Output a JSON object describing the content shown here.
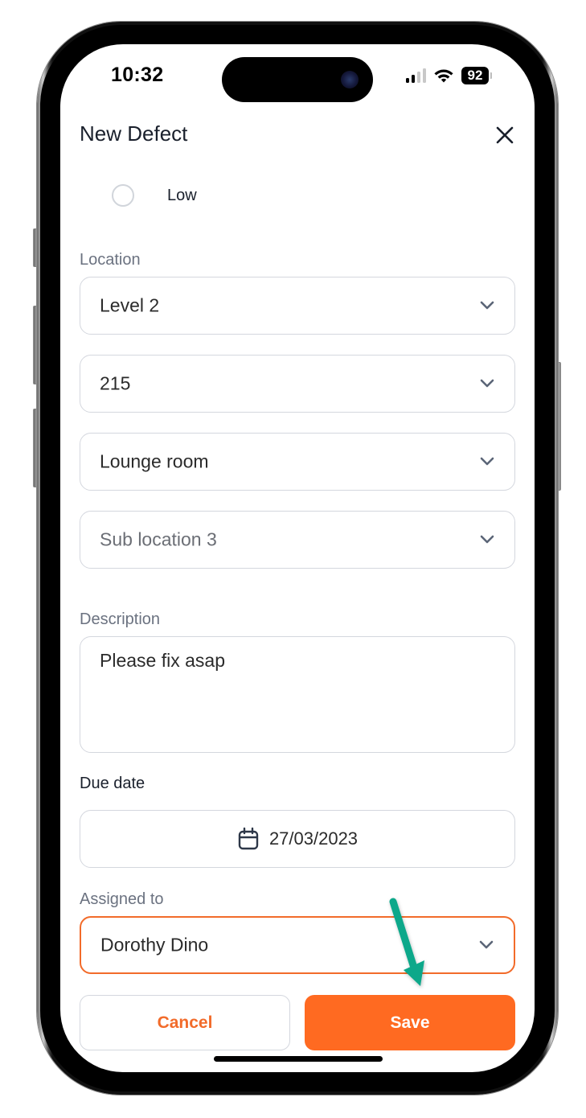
{
  "status_bar": {
    "time": "10:32",
    "battery": "92",
    "signal_bars_active": 2,
    "signal_bars_total": 4
  },
  "header": {
    "title": "New Defect",
    "close_icon": "close-icon"
  },
  "priority": {
    "option_label": "Low",
    "selected": false
  },
  "location": {
    "label": "Location",
    "level": "Level 2",
    "unit": "215",
    "room": "Lounge room",
    "sub_location_placeholder": "Sub location 3"
  },
  "description": {
    "label": "Description",
    "value": "Please fix asap"
  },
  "due_date": {
    "label": "Due date",
    "value": "27/03/2023",
    "icon": "calendar-icon"
  },
  "assigned_to": {
    "label": "Assigned to",
    "value": "Dorothy Dino"
  },
  "actions": {
    "cancel_label": "Cancel",
    "save_label": "Save"
  },
  "colors": {
    "accent": "#ff6a21",
    "focus_border": "#f26b2a",
    "annotation_arrow": "#0aa88a",
    "label_gray": "#6b7280",
    "text_dark": "#1a202c"
  }
}
